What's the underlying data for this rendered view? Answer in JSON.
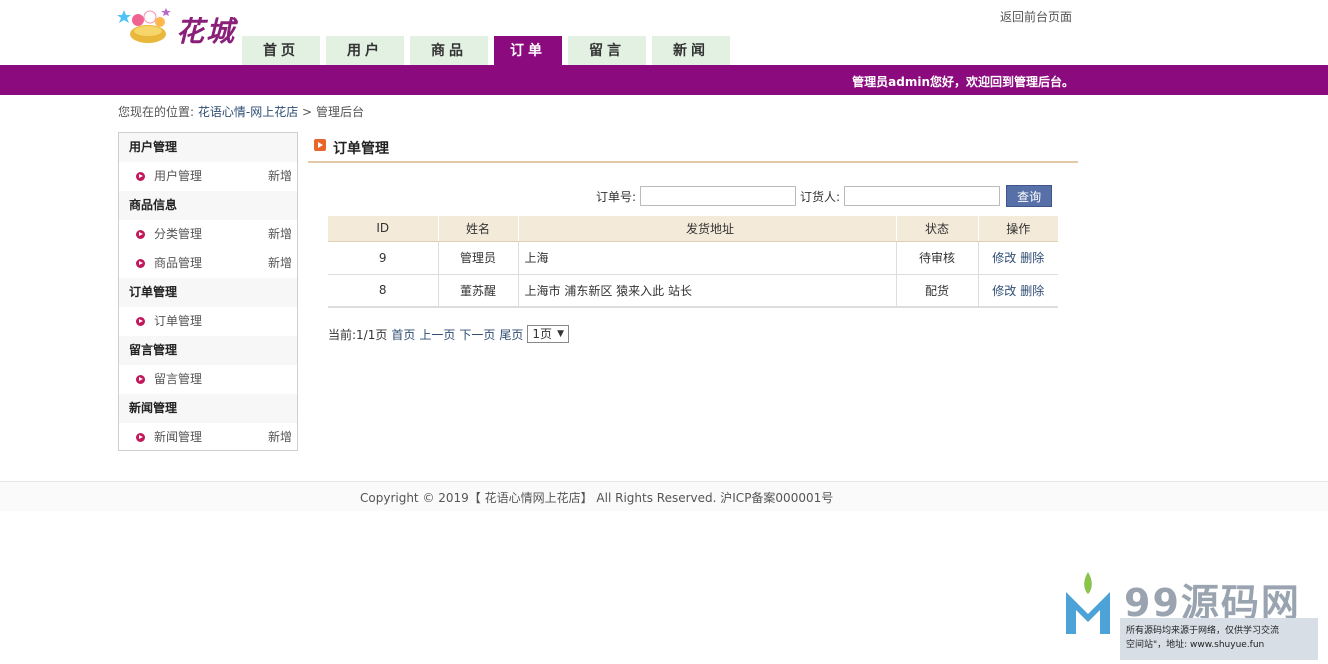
{
  "header": {
    "logo_text": "花城",
    "back_link": "返回前台页面",
    "nav": [
      "首页",
      "用户",
      "商品",
      "订单",
      "留言",
      "新闻"
    ],
    "active_tab": "订单",
    "welcome": "管理员admin您好，欢迎回到管理后台。"
  },
  "breadcrumb": {
    "prefix": "您现在的位置:",
    "link": "花语心情-网上花店",
    "sep": ">",
    "current": "管理后台"
  },
  "sidebar": {
    "groups": [
      {
        "title": "用户管理",
        "items": [
          {
            "label": "用户管理",
            "add": "新增"
          }
        ]
      },
      {
        "title": "商品信息",
        "items": [
          {
            "label": "分类管理",
            "add": "新增"
          },
          {
            "label": "商品管理",
            "add": "新增"
          }
        ]
      },
      {
        "title": "订单管理",
        "items": [
          {
            "label": "订单管理",
            "add": ""
          }
        ]
      },
      {
        "title": "留言管理",
        "items": [
          {
            "label": "留言管理",
            "add": ""
          }
        ]
      },
      {
        "title": "新闻管理",
        "items": [
          {
            "label": "新闻管理",
            "add": "新增"
          }
        ]
      }
    ]
  },
  "main": {
    "title": "订单管理",
    "search": {
      "order_no_label": "订单号:",
      "order_no_value": "",
      "orderer_label": "订货人:",
      "orderer_value": "",
      "button": "查询"
    },
    "table": {
      "headers": [
        "ID",
        "姓名",
        "发货地址",
        "状态",
        "操作"
      ],
      "rows": [
        {
          "id": "9",
          "name": "管理员",
          "address": "上海",
          "status": "待审核",
          "edit": "修改",
          "delete": "删除"
        },
        {
          "id": "8",
          "name": "董苏醒",
          "address": "上海市 浦东新区 猿来入此 站长",
          "status": "配货",
          "edit": "修改",
          "delete": "删除"
        }
      ]
    },
    "pager": {
      "current": "当前:1/1页",
      "first": "首页",
      "prev": "上一页",
      "next": "下一页",
      "last": "尾页",
      "select": "1页"
    }
  },
  "footer": {
    "text": "Copyright © 2019【 花语心情网上花店】 All Rights Reserved. 沪ICP备案000001号"
  },
  "watermark": {
    "brand": "99源码网",
    "line1": "所有源码均来源于网络，仅供学习交流",
    "line2": "空间站\"，地址: www.shuyue.fun"
  },
  "colors": {
    "primary_purple": "#8b0a7e",
    "tab_bg": "#e3f1e3",
    "table_header_bg": "#f3ead9",
    "button_blue": "#5870a8"
  }
}
